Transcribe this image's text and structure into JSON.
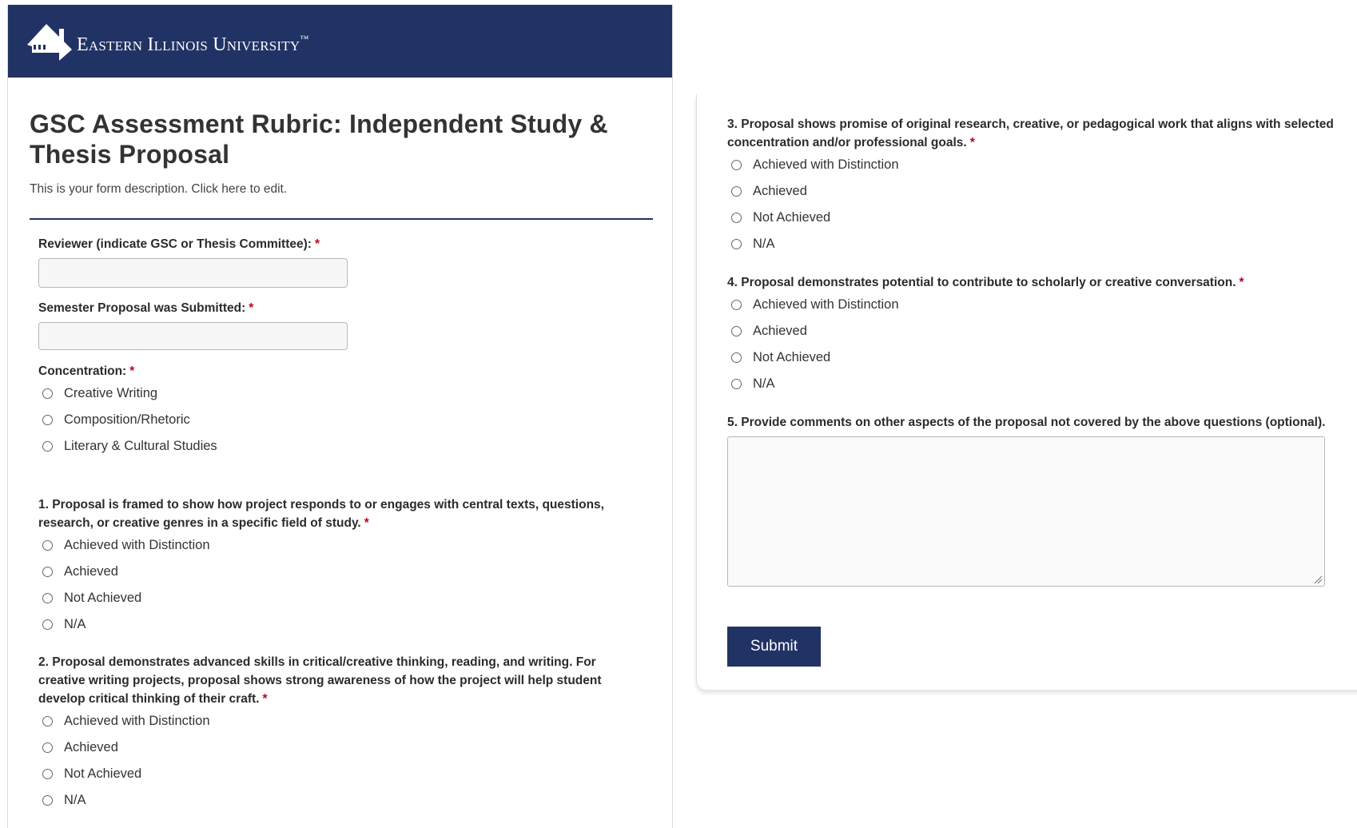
{
  "header": {
    "university_name": "Eastern Illinois University",
    "trademark": "™"
  },
  "form": {
    "title": "GSC Assessment Rubric: Independent Study & Thesis Proposal",
    "description": "This is your form description. Click here to edit.",
    "required_marker": "*"
  },
  "fields": {
    "reviewer": {
      "label": "Reviewer (indicate GSC or Thesis Committee):",
      "value": "",
      "placeholder": ""
    },
    "semester": {
      "label": "Semester Proposal was Submitted:",
      "value": "",
      "placeholder": ""
    },
    "concentration": {
      "label": "Concentration:",
      "options": [
        "Creative Writing",
        "Composition/Rhetoric",
        "Literary & Cultural Studies"
      ]
    }
  },
  "rating_options": [
    "Achieved with Distinction",
    "Achieved",
    "Not Achieved",
    "N/A"
  ],
  "questions": {
    "q1": "1. Proposal is framed to show how project responds to or engages with central texts, questions, research, or creative genres in a specific field of study.",
    "q2": "2. Proposal demonstrates advanced skills in critical/creative thinking, reading, and writing. For creative writing projects, proposal shows strong awareness of how the project will help student develop critical thinking of their craft.",
    "q3": "3. Proposal shows promise of original research, creative, or pedagogical work that aligns with selected concentration and/or professional goals.",
    "q4": "4. Proposal demonstrates potential to contribute to scholarly or creative conversation.",
    "q5": "5. Provide comments on other aspects of the proposal not covered by the above questions (optional)."
  },
  "comments": {
    "value": ""
  },
  "submit_label": "Submit",
  "colors": {
    "brand_navy": "#213265",
    "required_red": "#c0001e"
  }
}
